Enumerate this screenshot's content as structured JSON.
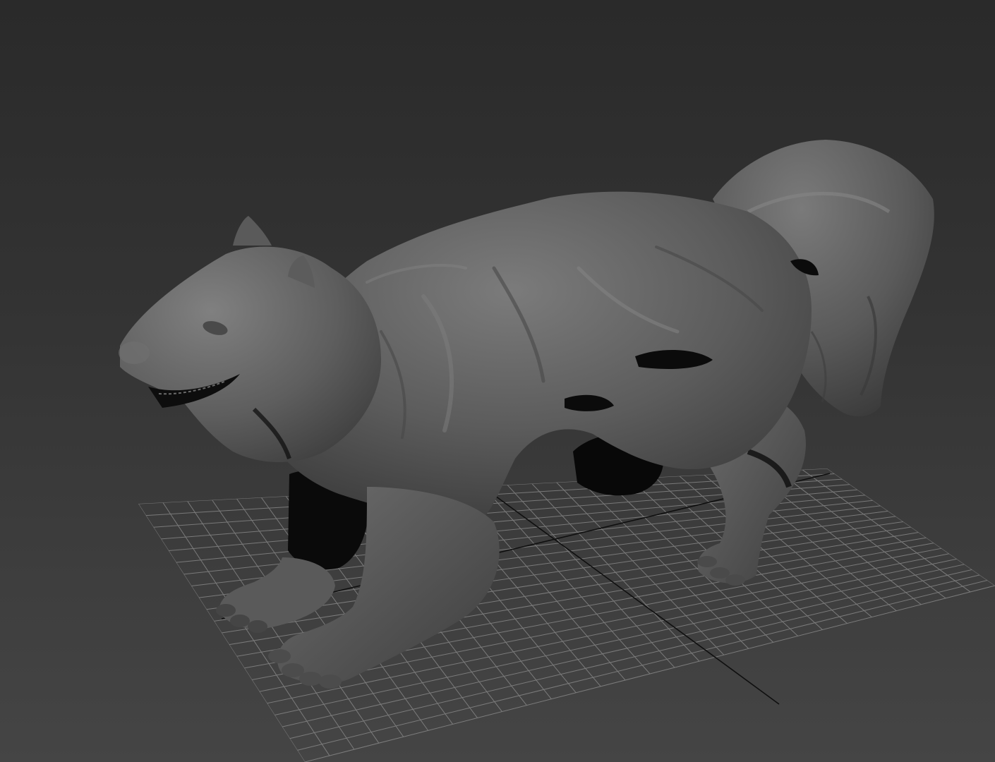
{
  "viewport": {
    "shading": "smooth-gray-clay",
    "grid_visible": true,
    "background_gradient": [
      "#2a2a2a",
      "#454545"
    ],
    "model_color": "#5e5e5e",
    "grid_color": "#8a8a8a",
    "axis_color": "#0f0f0f"
  },
  "model": {
    "subject": "wolverine-sculpt-icon"
  }
}
